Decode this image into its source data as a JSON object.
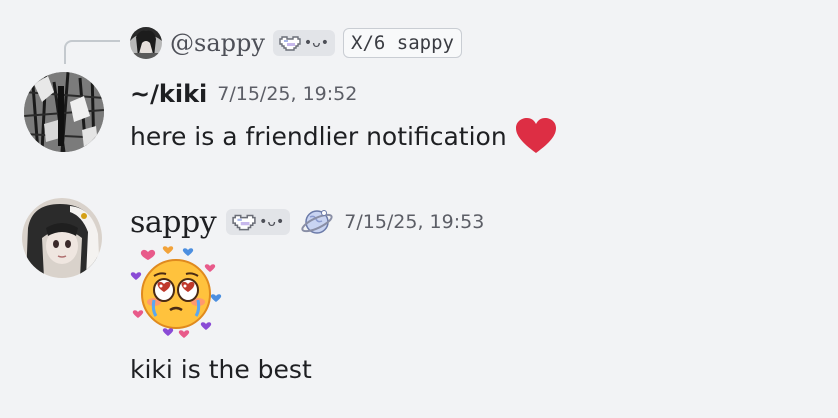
{
  "reply": {
    "username": "@sappy",
    "tag_text": "•ᴗ•",
    "mono_tag": "X/6 sappy"
  },
  "messages": [
    {
      "username": "~/kiki",
      "timestamp": "7/15/25, 19:52",
      "text": "here is a friendlier notification",
      "emoji": "red-heart"
    },
    {
      "username": "sappy",
      "tag_text": "•ᴗ•",
      "timestamp": "7/15/25, 19:53",
      "sticker": "pleading-hearts-face",
      "text": "kiki is the best"
    }
  ],
  "colors": {
    "background": "#f2f3f5",
    "username": "#1e1f22",
    "timestamp": "#5c5e66",
    "heart": "#dd2e44",
    "pill": "#e2e4e8"
  }
}
